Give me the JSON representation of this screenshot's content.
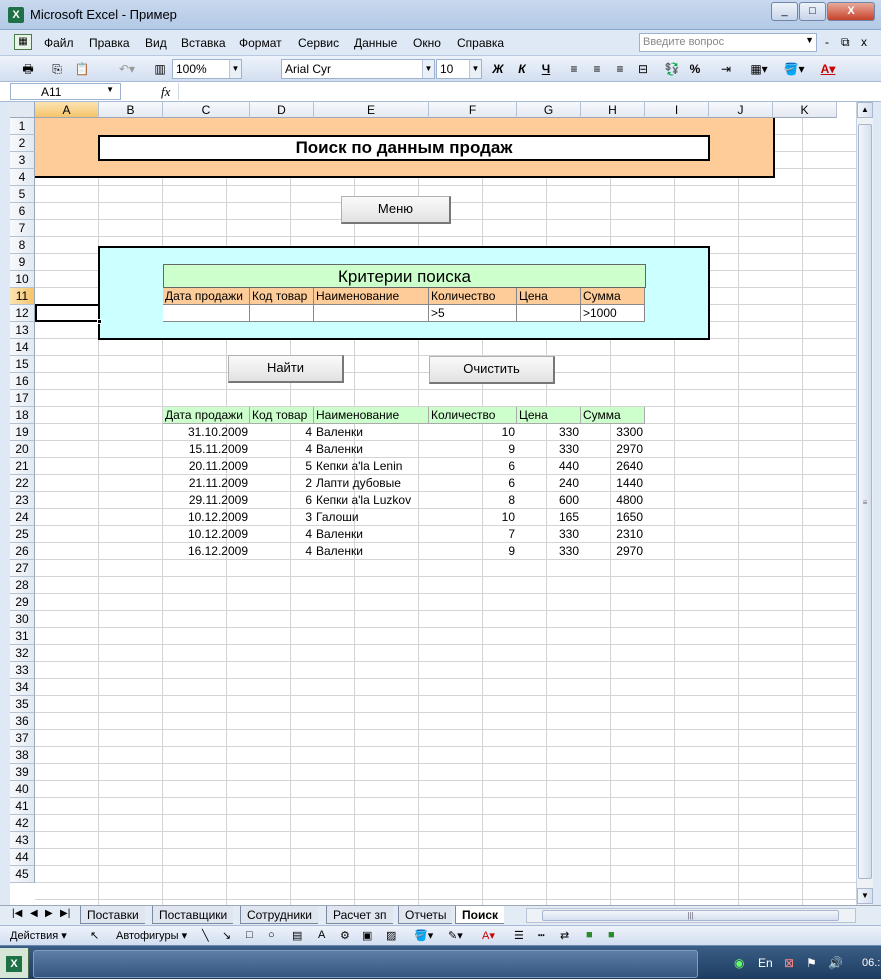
{
  "window": {
    "title": "Microsoft Excel - Пример",
    "app_icon": "excel-icon",
    "min": "_",
    "max": "□",
    "close": "X"
  },
  "menu": {
    "items": [
      "Файл",
      "Правка",
      "Вид",
      "Вставка",
      "Формат",
      "Сервис",
      "Данные",
      "Окно",
      "Справка"
    ],
    "ask_placeholder": "Введите вопрос",
    "mdi_min": "-",
    "mdi_restore": "⧉",
    "mdi_close": "x"
  },
  "toolbar": {
    "zoom": "100%",
    "font": "Arial Cyr",
    "size": "10",
    "bold": "Ж",
    "italic": "К",
    "underline": "Ч",
    "percent": "%"
  },
  "formula_bar": {
    "name_box": "A11",
    "fx": "fx",
    "formula": ""
  },
  "columns": [
    "A",
    "B",
    "C",
    "D",
    "E",
    "F",
    "G",
    "H",
    "I",
    "J",
    "K"
  ],
  "selected_column": "A",
  "rows": [
    "1",
    "2",
    "3",
    "4",
    "5",
    "6",
    "7",
    "8",
    "9",
    "10",
    "11",
    "12",
    "13",
    "14",
    "15",
    "16",
    "17",
    "18",
    "19",
    "20",
    "21",
    "22",
    "23",
    "24",
    "25",
    "26",
    "27",
    "28",
    "29",
    "30",
    "31",
    "32",
    "33",
    "34",
    "35",
    "36",
    "37",
    "38",
    "39",
    "40",
    "41",
    "42",
    "43",
    "44",
    "45"
  ],
  "selected_row": "11",
  "sheet": {
    "heading": "Поиск по данным продаж",
    "menu_button": "Меню",
    "criteria": {
      "title": "Критерии поиска",
      "headers": [
        "Дата продажи",
        "Код товар",
        "Наименование",
        "Количество",
        "Цена",
        "Сумма"
      ],
      "values": [
        "",
        "",
        "",
        ">5",
        "",
        ">1000"
      ]
    },
    "find_button": "Найти",
    "clear_button": "Очистить",
    "results": {
      "headers": [
        "Дата продажи",
        "Код товар",
        "Наименование",
        "Количество",
        "Цена",
        "Сумма"
      ],
      "rows": [
        [
          "31.10.2009",
          "4",
          "Валенки",
          "10",
          "330",
          "3300"
        ],
        [
          "15.11.2009",
          "4",
          "Валенки",
          "9",
          "330",
          "2970"
        ],
        [
          "20.11.2009",
          "5",
          "Кепки a'la Lenin",
          "6",
          "440",
          "2640"
        ],
        [
          "21.11.2009",
          "2",
          "Лапти дубовые",
          "6",
          "240",
          "1440"
        ],
        [
          "29.11.2009",
          "6",
          "Кепки a'la Luzkov",
          "8",
          "600",
          "4800"
        ],
        [
          "10.12.2009",
          "3",
          "Галоши",
          "10",
          "165",
          "1650"
        ],
        [
          "10.12.2009",
          "4",
          "Валенки",
          "7",
          "330",
          "2310"
        ],
        [
          "16.12.2009",
          "4",
          "Валенки",
          "9",
          "330",
          "2970"
        ]
      ]
    }
  },
  "tabs": {
    "items": [
      "Поставки",
      "Поставщики",
      "Сотрудники",
      "Расчет зп",
      "Отчеты",
      "Поиск"
    ],
    "active": "Поиск"
  },
  "drawbar": {
    "actions": "Действия ▾",
    "autoshapes": "Автофигуры ▾"
  },
  "taskbar": {
    "lang": "En",
    "clock": "06.:"
  },
  "colors": {
    "orange": "#fdcc99",
    "cyan": "#ccffff",
    "green": "#ccffcc"
  }
}
